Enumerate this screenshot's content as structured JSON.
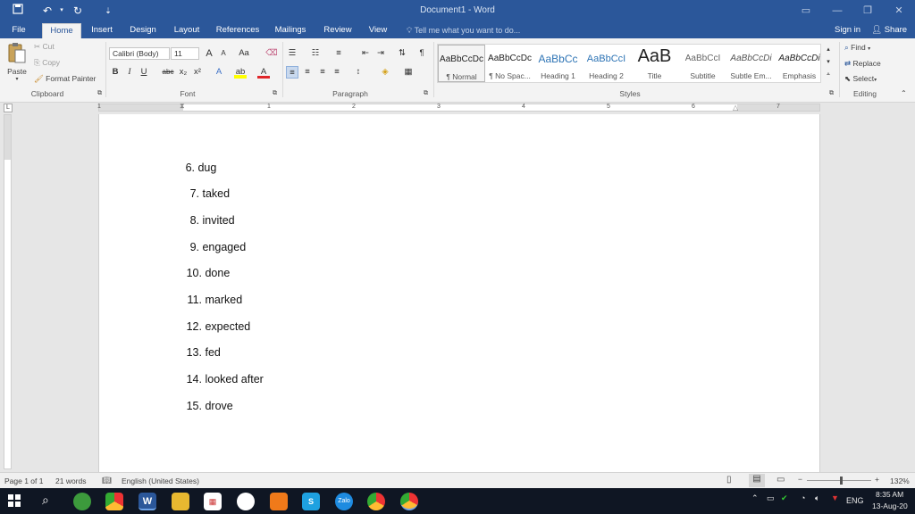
{
  "title_bar": {
    "document_title": "Document1 - Word",
    "save_icon": "save-icon",
    "undo_icon": "undo-icon",
    "redo_icon": "redo-icon"
  },
  "tabs": [
    {
      "label": "File",
      "active": false
    },
    {
      "label": "Home",
      "active": true
    },
    {
      "label": "Insert",
      "active": false
    },
    {
      "label": "Design",
      "active": false
    },
    {
      "label": "Layout",
      "active": false
    },
    {
      "label": "References",
      "active": false
    },
    {
      "label": "Mailings",
      "active": false
    },
    {
      "label": "Review",
      "active": false
    },
    {
      "label": "View",
      "active": false
    }
  ],
  "tell_me": "Tell me what you want to do...",
  "sign_in": "Sign in",
  "share": "Share",
  "clipboard": {
    "paste": "Paste",
    "cut": "Cut",
    "copy": "Copy",
    "format_painter": "Format Painter",
    "label": "Clipboard"
  },
  "font": {
    "name": "Calibri (Body)",
    "size": "11",
    "label": "Font",
    "bold": "B",
    "italic": "I",
    "underline": "U",
    "strike": "abc",
    "subscript": "x₂",
    "superscript": "x²",
    "grow": "A",
    "shrink": "A",
    "case": "Aa"
  },
  "paragraph": {
    "label": "Paragraph",
    "pilcrow": "¶"
  },
  "styles": {
    "label": "Styles",
    "items": [
      {
        "preview": "AaBbCcDc",
        "name": "¶ Normal",
        "selected": true
      },
      {
        "preview": "AaBbCcDc",
        "name": "¶ No Spac...",
        "selected": false
      },
      {
        "preview": "AaBbCc",
        "name": "Heading 1",
        "selected": false
      },
      {
        "preview": "AaBbCcI",
        "name": "Heading 2",
        "selected": false
      },
      {
        "preview": "AaB",
        "name": "Title",
        "selected": false
      },
      {
        "preview": "AaBbCcI",
        "name": "Subtitle",
        "selected": false
      },
      {
        "preview": "AaBbCcDi",
        "name": "Subtle Em...",
        "selected": false
      },
      {
        "preview": "AaBbCcDi",
        "name": "Emphasis",
        "selected": false
      }
    ]
  },
  "editing": {
    "label": "Editing",
    "find": "Find",
    "replace": "Replace",
    "select": "Select"
  },
  "ruler_numbers": [
    "1",
    "1",
    "2",
    "3",
    "4",
    "5",
    "6",
    "7"
  ],
  "document": {
    "list_items": [
      {
        "num": "6.",
        "text": "dug"
      },
      {
        "num": "7.",
        "text": "taked"
      },
      {
        "num": "8.",
        "text": "invited"
      },
      {
        "num": "9.",
        "text": "engaged"
      },
      {
        "num": "10.",
        "text": "done"
      },
      {
        "num": "11.",
        "text": "marked"
      },
      {
        "num": "12.",
        "text": "expected"
      },
      {
        "num": "13.",
        "text": "fed"
      },
      {
        "num": "14.",
        "text": "looked after"
      },
      {
        "num": "15.",
        "text": "drove"
      }
    ]
  },
  "status_bar": {
    "page": "Page 1 of 1",
    "words": "21 words",
    "language": "English (United States)",
    "zoom": "132%"
  },
  "taskbar": {
    "lang": "ENG",
    "time": "8:35 AM",
    "date": "13-Aug-20"
  },
  "colors": {
    "word_blue": "#2b579a",
    "ribbon_bg": "#f3f3f3",
    "taskbar_bg": "#0f1623"
  }
}
